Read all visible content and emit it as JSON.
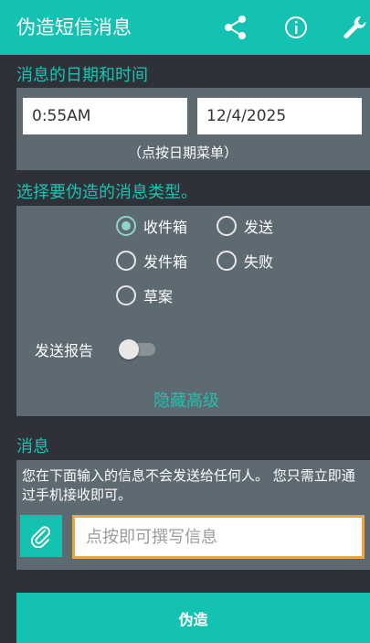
{
  "app": {
    "title": "伪造短信消息",
    "actions": [
      {
        "name": "share-icon"
      },
      {
        "name": "info-icon"
      },
      {
        "name": "wrench-icon"
      }
    ]
  },
  "datetime": {
    "section_title": "消息的日期和时间",
    "time_value": "0:55AM",
    "date_value": "12/4/2025",
    "hint": "（点按日期菜单）"
  },
  "message_type": {
    "section_title": "选择要伪造的消息类型。",
    "options": [
      {
        "label": "收件箱",
        "selected": true
      },
      {
        "label": "发送",
        "selected": false
      },
      {
        "label": "发件箱",
        "selected": false
      },
      {
        "label": "失败",
        "selected": false
      },
      {
        "label": "草案",
        "selected": false
      }
    ],
    "delivery_report_label": "发送报告",
    "delivery_report_on": false,
    "hide_advanced_label": "隐藏高级"
  },
  "message": {
    "section_title": "消息",
    "info_text": "您在下面输入的信息不会发送给任何人。 您只需立即通过手机接收即可。",
    "compose_placeholder": "点按即可撰写信息"
  },
  "action": {
    "fake_label": "伪造"
  },
  "colors": {
    "accent": "#13c2b0",
    "background": "#2e3138",
    "panel": "#5e6a72",
    "focus_border": "#f2a43a"
  }
}
